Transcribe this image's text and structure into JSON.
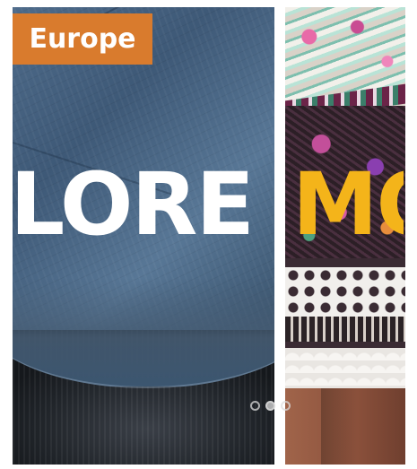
{
  "banner": {
    "category_label": "Europe",
    "headline_left": "LORE",
    "headline_right": "MO",
    "colors": {
      "badge_background": "#d97b2d",
      "headline_left": "#ffffff",
      "headline_right": "#f4b41a"
    },
    "slides": [
      {
        "label": "slide-1",
        "active": false
      },
      {
        "label": "slide-2",
        "active": true
      },
      {
        "label": "slide-3",
        "active": false
      }
    ]
  }
}
